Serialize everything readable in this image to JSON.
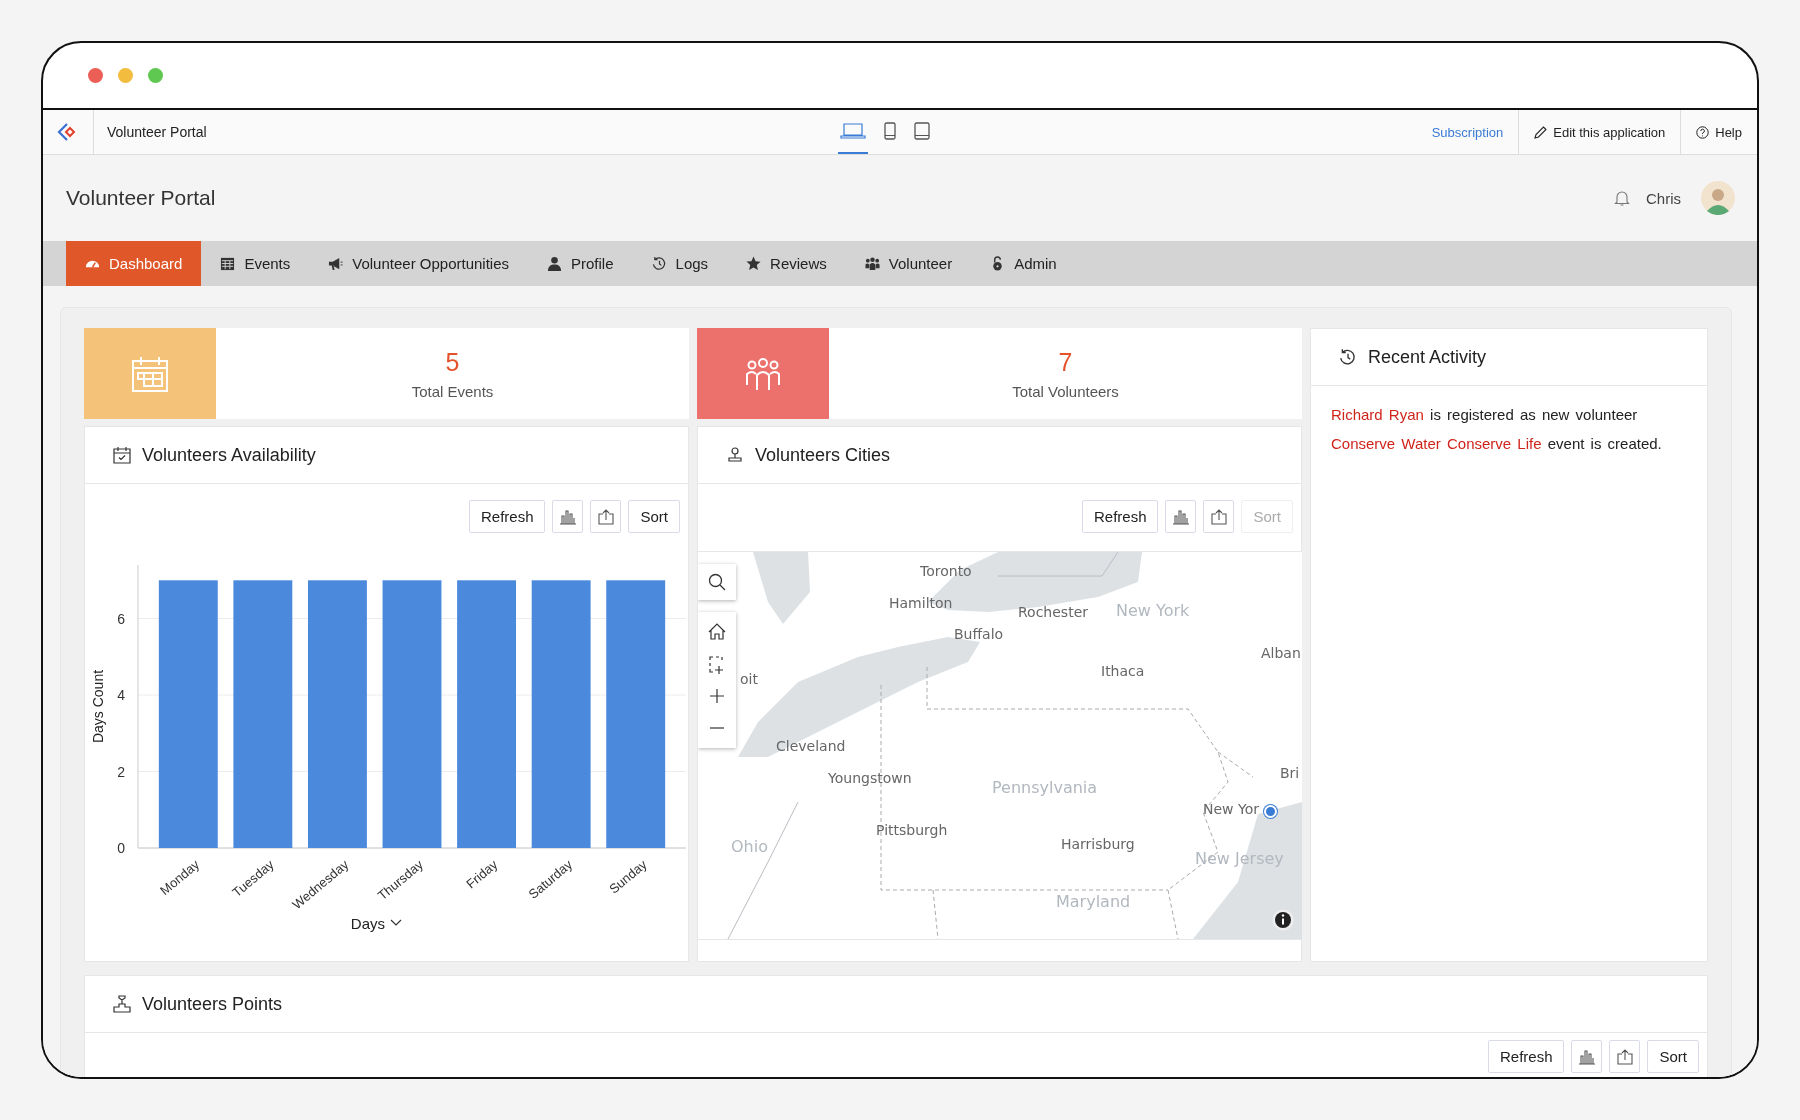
{
  "app_bar": {
    "title": "Volunteer Portal",
    "devices": [
      {
        "kind": "desktop",
        "selected": true
      },
      {
        "kind": "phone",
        "selected": false
      },
      {
        "kind": "tablet",
        "selected": false
      }
    ],
    "links": [
      {
        "kind": "subscription",
        "label": "Subscription"
      },
      {
        "kind": "edit",
        "label": "Edit this application"
      },
      {
        "kind": "help",
        "label": "Help"
      }
    ]
  },
  "header": {
    "title": "Volunteer Portal",
    "user": "Chris"
  },
  "nav": [
    {
      "kind": "dashboard",
      "label": "Dashboard",
      "selected": true
    },
    {
      "kind": "events",
      "label": "Events",
      "selected": false
    },
    {
      "kind": "opportunities",
      "label": "Volunteer Opportunities",
      "selected": false
    },
    {
      "kind": "profile",
      "label": "Profile",
      "selected": false
    },
    {
      "kind": "logs",
      "label": "Logs",
      "selected": false
    },
    {
      "kind": "reviews",
      "label": "Reviews",
      "selected": false
    },
    {
      "kind": "volunteer",
      "label": "Volunteer",
      "selected": false
    },
    {
      "kind": "admin",
      "label": "Admin",
      "selected": false
    }
  ],
  "stats": [
    {
      "kind": "events",
      "value": "5",
      "label": "Total Events",
      "color": "#f5c27a"
    },
    {
      "kind": "volunteers",
      "value": "7",
      "label": "Total Volunteers",
      "color": "#ec706c"
    }
  ],
  "availability": {
    "title": "Volunteers Availability",
    "toolbar": [
      {
        "kind": "text",
        "label": "Refresh",
        "disabled": false
      },
      {
        "kind": "chart-type",
        "disabled": false
      },
      {
        "kind": "export",
        "disabled": false
      },
      {
        "kind": "text",
        "label": "Sort",
        "disabled": false
      }
    ],
    "chart_data": {
      "type": "bar",
      "xlabel": "Days",
      "ylabel": "Days Count",
      "categories": [
        "Monday",
        "Tuesday",
        "Wednesday",
        "Thursday",
        "Friday",
        "Saturday",
        "Sunday"
      ],
      "series": [
        {
          "color": "#4a89dc",
          "values": [
            7,
            7,
            7,
            7,
            7,
            7,
            7
          ]
        }
      ],
      "ylim": [
        0,
        7.4
      ],
      "yticks": [
        0,
        2,
        4,
        6
      ],
      "grid": true
    }
  },
  "cities": {
    "title": "Volunteers Cities",
    "toolbar": [
      {
        "kind": "text",
        "label": "Refresh",
        "disabled": false
      },
      {
        "kind": "chart-type",
        "disabled": false
      },
      {
        "kind": "export",
        "disabled": false
      },
      {
        "kind": "text",
        "label": "Sort",
        "disabled": true
      }
    ],
    "map_labels": [
      {
        "kind": "city",
        "text": "Toronto"
      },
      {
        "kind": "city",
        "text": "Hamilton"
      },
      {
        "kind": "city",
        "text": "Rochester"
      },
      {
        "kind": "region",
        "text": "New York"
      },
      {
        "kind": "city",
        "text": "Buffalo"
      },
      {
        "kind": "city",
        "text": "Alban"
      },
      {
        "kind": "city",
        "text": "Ithaca"
      },
      {
        "kind": "city",
        "text": "oit"
      },
      {
        "kind": "city",
        "text": "Cleveland"
      },
      {
        "kind": "city",
        "text": "Youngstown"
      },
      {
        "kind": "region",
        "text": "Pennsylvania"
      },
      {
        "kind": "city",
        "text": "Bri"
      },
      {
        "kind": "city",
        "text": "New Yor"
      },
      {
        "kind": "city",
        "text": "Pittsburgh"
      },
      {
        "kind": "region",
        "text": "Ohio"
      },
      {
        "kind": "city",
        "text": "Harrisburg"
      },
      {
        "kind": "region",
        "text": "New Jersey"
      },
      {
        "kind": "region",
        "text": "Maryland"
      }
    ]
  },
  "recent_activity": {
    "title": "Recent Activity",
    "items": [
      {
        "link": "Richard Ryan",
        "text": "is registered as new volunteer"
      },
      {
        "link": "Conserve Water Conserve Life",
        "text": "event is created."
      }
    ]
  },
  "points": {
    "title": "Volunteers Points",
    "toolbar": [
      {
        "kind": "text",
        "label": "Refresh",
        "disabled": false
      },
      {
        "kind": "chart-type",
        "disabled": false
      },
      {
        "kind": "export",
        "disabled": false
      },
      {
        "kind": "text",
        "label": "Sort",
        "disabled": false
      }
    ]
  }
}
